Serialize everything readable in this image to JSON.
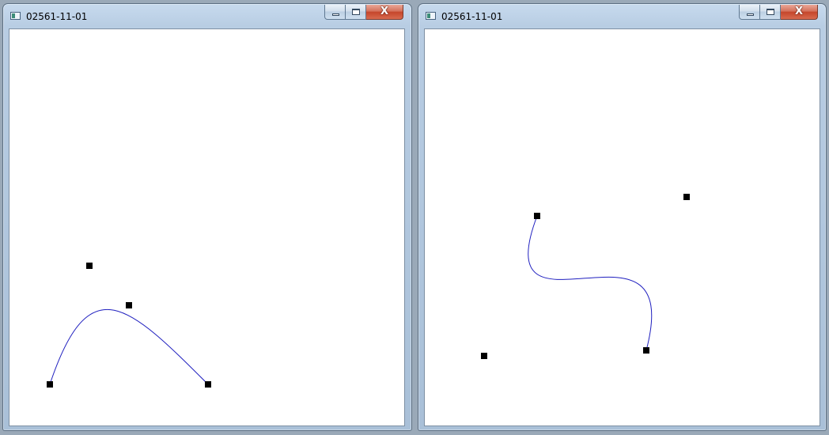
{
  "windows": [
    {
      "title": "02561-11-01",
      "controls": {
        "minimize_icon": "minimize-icon",
        "maximize_icon": "maximize-icon",
        "close_icon": "close-icon",
        "close_glyph": "X"
      },
      "colors": {
        "curve": "#1f1fbf",
        "point": "#000000"
      }
    },
    {
      "title": "02561-11-01",
      "controls": {
        "minimize_icon": "minimize-icon",
        "maximize_icon": "maximize-icon",
        "close_icon": "close-icon",
        "close_glyph": "X"
      },
      "colors": {
        "curve": "#1f1fbf",
        "point": "#000000"
      }
    }
  ]
}
